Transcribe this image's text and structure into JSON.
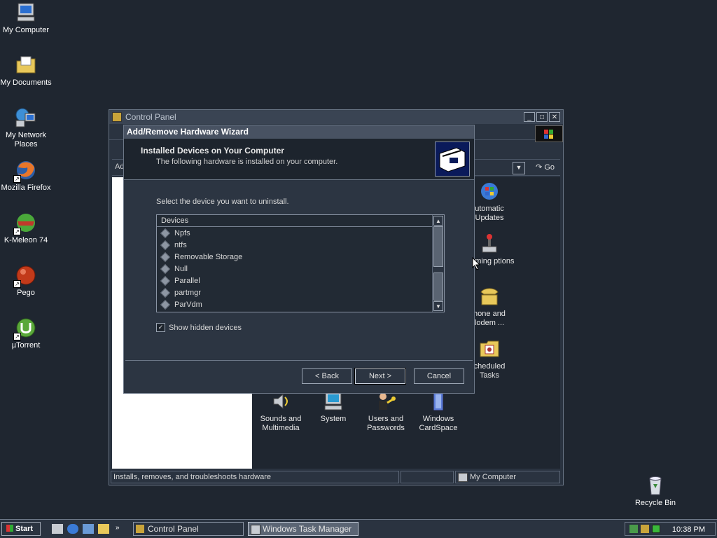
{
  "desktop": {
    "icons": [
      {
        "label": "My Computer"
      },
      {
        "label": "My Documents"
      },
      {
        "label": "My Network Places"
      },
      {
        "label": "Mozilla Firefox"
      },
      {
        "label": "K-Meleon 74"
      },
      {
        "label": "Pego"
      },
      {
        "label": "µTorrent"
      },
      {
        "label": "Recycle Bin"
      }
    ]
  },
  "control_panel": {
    "title": "Control Panel",
    "address_label": "Ad",
    "go_label": "Go",
    "items": [
      {
        "label": "utomatic Updates"
      },
      {
        "label": "Gaming ptions"
      },
      {
        "label": "hone and lodem ..."
      },
      {
        "label": "cheduled Tasks"
      },
      {
        "label": "Sounds and Multimedia"
      },
      {
        "label": "System"
      },
      {
        "label": "Users and Passwords"
      },
      {
        "label": "Windows CardSpace"
      }
    ],
    "status": {
      "description": "Installs, removes, and troubleshoots hardware",
      "zone": "My Computer"
    }
  },
  "wizard": {
    "title": "Add/Remove Hardware Wizard",
    "heading": "Installed Devices on Your Computer",
    "subheading": "The following hardware is installed on your computer.",
    "prompt": "Select the device you want to uninstall.",
    "list_header": "Devices",
    "devices": [
      "Npfs",
      "ntfs",
      "Removable Storage",
      "Null",
      "Parallel",
      "partmgr",
      "ParVdm"
    ],
    "show_hidden_label": "Show hidden devices",
    "show_hidden_checked": true,
    "back_label": "< Back",
    "next_label": "Next >",
    "cancel_label": "Cancel"
  },
  "taskbar": {
    "start_label": "Start",
    "tasks": [
      {
        "label": "Control Panel"
      },
      {
        "label": "Windows Task Manager"
      }
    ],
    "clock": "10:38 PM"
  }
}
